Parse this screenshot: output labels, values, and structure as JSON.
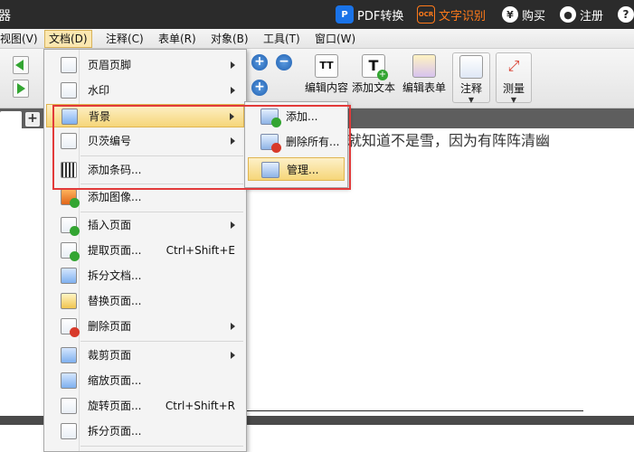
{
  "titlebar": {
    "app_char": "器",
    "pdf_convert": "PDF转换",
    "pdf_icon": "P",
    "ocr_icon": "OCR",
    "ocr_text": "文字识别",
    "buy_icon": "¥",
    "buy": "购买",
    "user_icon": "●",
    "register": "注册",
    "help_icon": "?"
  },
  "menubar": {
    "items": [
      {
        "label": "视图(V)"
      },
      {
        "label": "文档(D)"
      },
      {
        "label": "注释(C)"
      },
      {
        "label": "表单(R)"
      },
      {
        "label": "对象(B)"
      },
      {
        "label": "工具(T)"
      },
      {
        "label": "窗口(W)"
      }
    ]
  },
  "toolbar": {
    "zoom_in": "+",
    "zoom_out": "−",
    "zoom_fit": "+",
    "edit_content": "编辑内容",
    "add_text": "添加文本",
    "edit_form": "编辑表单",
    "annotate": "注释",
    "measure": "测量",
    "caret": "▼",
    "text_icon_glyph": "T",
    "text_icon_glyph2": "TT",
    "plus": "+"
  },
  "tabs": {
    "add": "+"
  },
  "document": {
    "text": "就知道不是雪，因为有阵阵清幽"
  },
  "dropdown": {
    "items": [
      {
        "label": "页眉页脚"
      },
      {
        "label": "水印"
      },
      {
        "label": "背景"
      },
      {
        "label": "贝茨编号"
      },
      {
        "label": "添加条码..."
      },
      {
        "label": "添加图像..."
      },
      {
        "label": "插入页面"
      },
      {
        "label": "提取页面...",
        "shortcut": "Ctrl+Shift+E"
      },
      {
        "label": "拆分文档..."
      },
      {
        "label": "替换页面..."
      },
      {
        "label": "删除页面"
      },
      {
        "label": "裁剪页面"
      },
      {
        "label": "缩放页面..."
      },
      {
        "label": "旋转页面...",
        "shortcut": "Ctrl+Shift+R"
      },
      {
        "label": "拆分页面..."
      }
    ]
  },
  "submenu": {
    "items": [
      {
        "label": "添加..."
      },
      {
        "label": "删除所有..."
      },
      {
        "label": "管理..."
      }
    ]
  },
  "colors": {
    "titlebar_bg": "#2b2b2b",
    "ocr_accent": "#ff7a1a",
    "highlight": "#f6d679",
    "annotation_red": "#e23a3a"
  }
}
